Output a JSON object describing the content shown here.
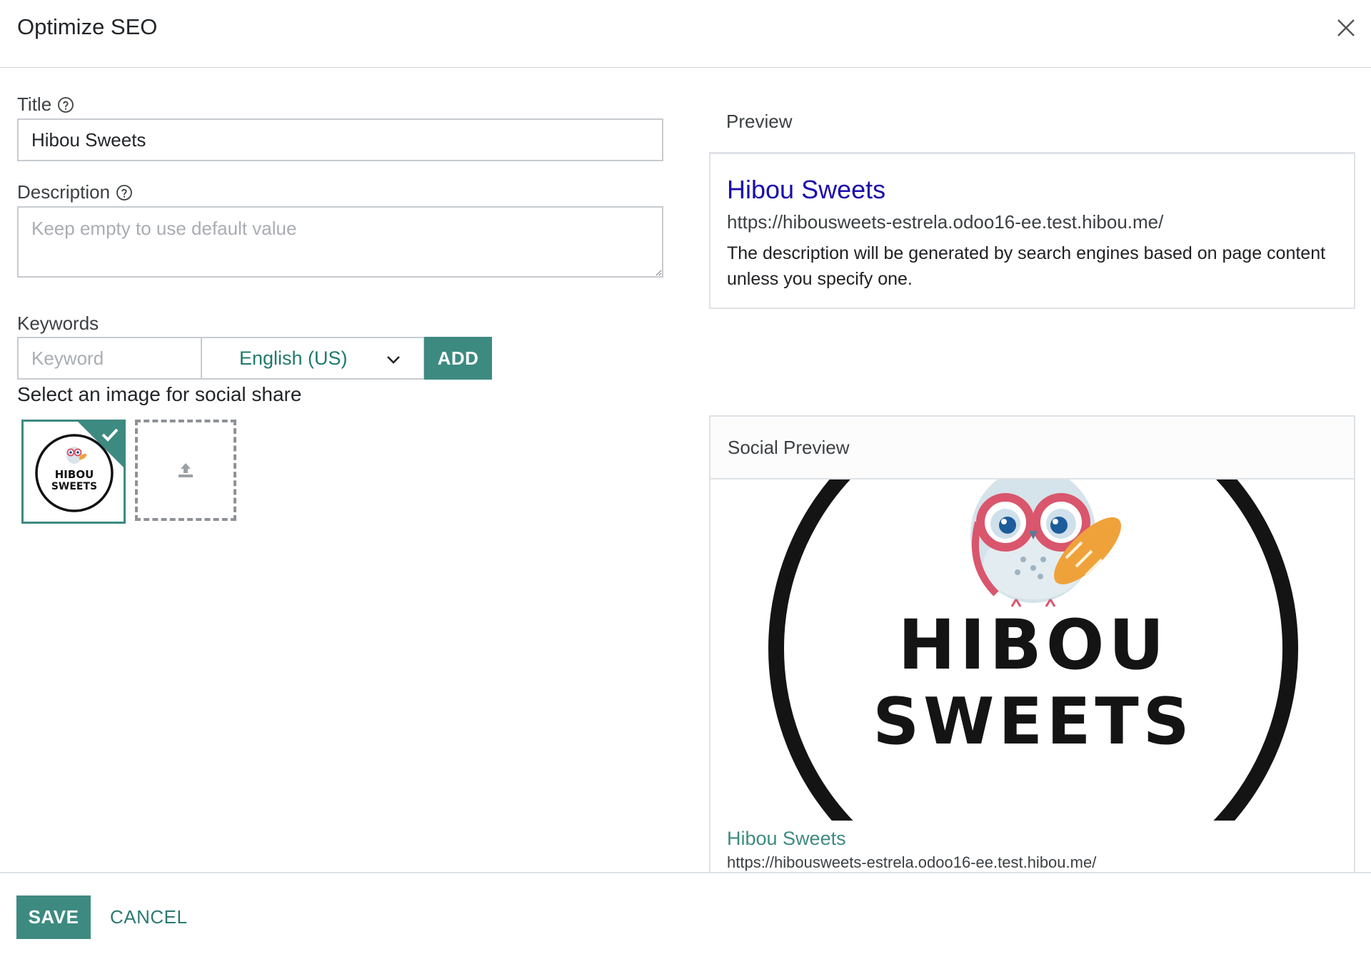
{
  "dialog": {
    "title": "Optimize SEO",
    "close_icon": "close-icon"
  },
  "form": {
    "title_label": "Title",
    "title_value": "Hibou Sweets",
    "description_label": "Description",
    "description_placeholder": "Keep empty to use default value",
    "description_value": "",
    "keywords_label": "Keywords",
    "keyword_placeholder": "Keyword",
    "keyword_value": "",
    "language_selected": "English (US)",
    "add_label": "ADD",
    "social_image_label": "Select an image for social share",
    "help_icon": "help-circle-icon",
    "upload_icon": "upload-icon"
  },
  "preview": {
    "label": "Preview",
    "title": "Hibou Sweets",
    "url": "https://hibousweets-estrela.odoo16-ee.test.hibou.me/",
    "description": "The description will be generated by search engines based on page content unless you specify one."
  },
  "social_preview": {
    "label": "Social Preview",
    "logo_line1": "HIBOU",
    "logo_line2": "SWEETS",
    "title": "Hibou Sweets",
    "url": "https://hibousweets-estrela.odoo16-ee.test.hibou.me/"
  },
  "footer": {
    "save_label": "SAVE",
    "cancel_label": "CANCEL"
  },
  "colors": {
    "accent": "#3d8a81",
    "link_blue": "#1a0dab"
  }
}
